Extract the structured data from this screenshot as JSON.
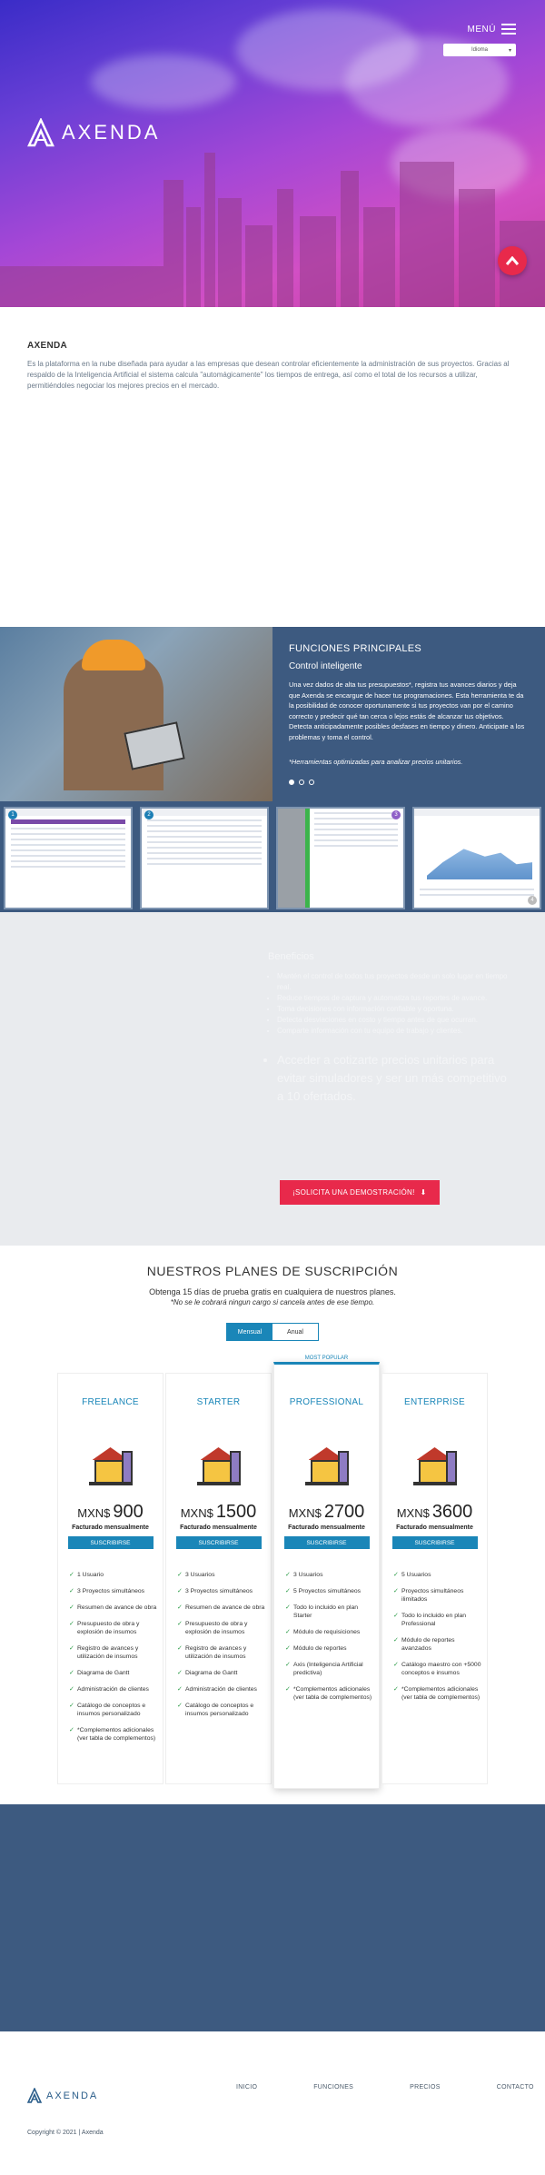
{
  "header": {
    "menu_label": "MENÚ",
    "language_selected": "Idioma",
    "logo_text": "AXENDA"
  },
  "intro": {
    "title": "AXENDA",
    "description": "Es la plataforma en la nube diseñada para ayudar a las empresas que desean controlar eficientemente la administración de sus proyectos. Gracias al respaldo de la Inteligencia Artificial el sistema calcula \"automágicamente\" los tiempos de entrega, así como el total de los recursos a utilizar, permitiéndoles negociar los mejores precios en el mercado."
  },
  "features": {
    "heading": "FUNCIONES PRINCIPALES",
    "subheading": "Control inteligente",
    "body": "Una vez dados de alta tus presupuestos*, registra tus avances diarios y deja que Axenda se encargue de hacer tus programaciones. Esta herramienta te da la posibilidad de conocer oportunamente si tus proyectos van por el camino correcto y predecir qué tan cerca o lejos estás de alcanzar tus objetivos. Detecta anticipadamente posibles desfases en tiempo y dinero. Anticipate a los problemas y toma el control.",
    "note": "*Herramientas optimizadas para analizar precios unitarios.",
    "thumbnail_badges": [
      "1",
      "2",
      "3",
      "4"
    ]
  },
  "benefits": {
    "heading": "Beneficios",
    "items": [
      "Mantén el control de todos tus proyectos desde un solo lugar en tiempo real.",
      "Reduce tiempos de captura y automatiza tus reportes de avance.",
      "Toma decisiones con información confiable y oportuna.",
      "Detecta desviaciones en costo y tiempo antes de que ocurran.",
      "Comparte información con tu equipo de trabajo y clientes."
    ],
    "highlight": "Acceder a cotizarte precios unitarios para evitar simuladores y ser un más competitivo a 10 ofertados.",
    "demo_button": "¡SOLICITA UNA DEMOSTRACIÓN!"
  },
  "plans": {
    "title": "NUESTROS PLANES DE SUSCRIPCIÓN",
    "trial": "Obtenga 15 días de prueba gratis en cualquiera de nuestros planes.",
    "trial_note": "*No se le cobrará ningun cargo si cancela antes de ese tiempo.",
    "toggle": [
      "Mensual",
      "Anual"
    ],
    "popular_label": "MOST POPULAR",
    "currency": "MXN$",
    "billed": "Facturado mensualmente",
    "subscribe": "SUSCRIBIRSE",
    "items": [
      {
        "name": "FREELANCE",
        "price": "900",
        "features": [
          "1 Usuario",
          "3 Proyectos simultáneos",
          "Resumen de avance de obra",
          "Presupuesto de obra y explosión de insumos",
          "Registro de avances y utilización de insumos",
          "Diagrama de Gantt",
          "Administración de clientes",
          "Catálogo de conceptos e insumos personalizado",
          "*Complementos adicionales (ver tabla de complementos)"
        ]
      },
      {
        "name": "STARTER",
        "price": "1500",
        "features": [
          "3 Usuarios",
          "3 Proyectos simultáneos",
          "Resumen de avance de obra",
          "Presupuesto de obra y explosión de insumos",
          "Registro de avances y utilización de insumos",
          "Diagrama de Gantt",
          "Administración de clientes",
          "Catálogo de conceptos e insumos personalizado"
        ]
      },
      {
        "name": "PROFESSIONAL",
        "price": "2700",
        "features": [
          "3 Usuarios",
          "5 Proyectos simultáneos",
          "Todo lo incluido en plan Starter",
          "Módulo de requisiciones",
          "Módulo de reportes",
          "Axis (Inteligencia Artificial predictiva)",
          "*Complementos adicionales (ver tabla de complementos)"
        ]
      },
      {
        "name": "ENTERPRISE",
        "price": "3600",
        "features": [
          "5 Usuarios",
          "Proyectos simultáneos ilimitados",
          "Todo lo incluido en plan Professional",
          "Módulo de reportes avanzados",
          "Catálogo maestro con +5000 conceptos e insumos",
          "*Complementos adicionales (ver tabla de complementos)"
        ]
      }
    ]
  },
  "footer": {
    "logo_text": "AXENDA",
    "nav": [
      "INICIO",
      "FUNCIONES",
      "PRECIOS",
      "CONTACTO"
    ],
    "copyright": "Copyright © 2021 | Axenda"
  },
  "colors": {
    "accent": "#e8294b",
    "primary_blue": "#1a86b8",
    "band": "#3d5a80"
  }
}
